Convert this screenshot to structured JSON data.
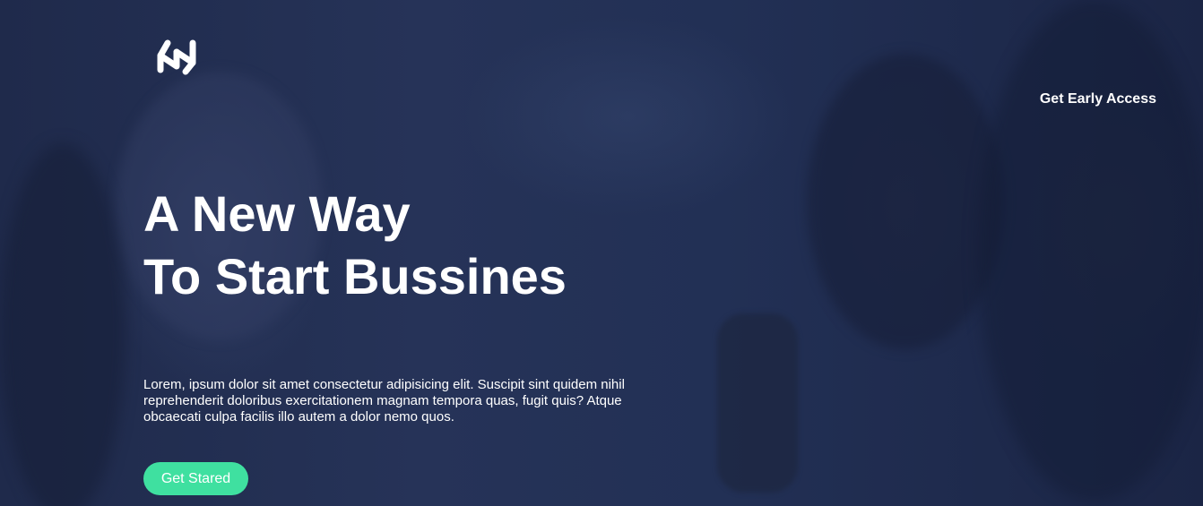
{
  "nav": {
    "logo_icon": "brand-mark-icon",
    "cta_label": "Get Early Access"
  },
  "hero": {
    "headline_line1": "A New Way",
    "headline_line2": "To Start Bussines",
    "lead": "Lorem, ipsum dolor sit amet consectetur adipisicing elit. Suscipit sint quidem nihil reprehenderit doloribus exercitationem magnam tempora quas, fugit quis? Atque obcaecati culpa facilis illo autem a dolor nemo quos.",
    "button_label": "Get Stared"
  },
  "colors": {
    "overlay": "#1e2a4a",
    "accent": "#3fe0a0",
    "text": "#ffffff"
  }
}
